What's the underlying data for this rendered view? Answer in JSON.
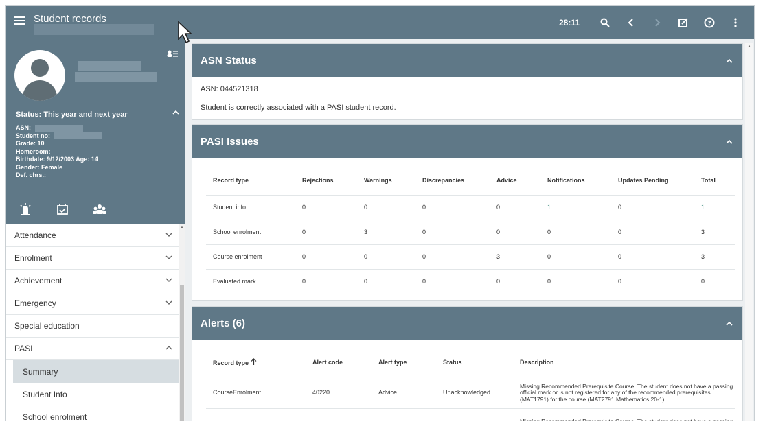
{
  "topbar": {
    "title": "Student records",
    "timer": "28:11"
  },
  "sidebar": {
    "status": "Status: This year and next year",
    "details": {
      "asn_label": "ASN:",
      "student_no_label": "Student no:",
      "grade": "Grade:  10",
      "homeroom": "Homeroom:",
      "birthdate": "Birthdate:  9/12/2003    Age:  14",
      "gender": "Gender:  Female",
      "def_chrs": "Def. chrs.:"
    },
    "nav": [
      {
        "label": "Attendance"
      },
      {
        "label": "Enrolment"
      },
      {
        "label": "Achievement"
      },
      {
        "label": "Emergency"
      },
      {
        "label": "Special education"
      },
      {
        "label": "PASI"
      }
    ],
    "sub_nav": [
      {
        "label": "Summary"
      },
      {
        "label": "Student Info"
      },
      {
        "label": "School enrolment"
      }
    ]
  },
  "asn_status": {
    "title": "ASN Status",
    "asn_line": "ASN: 044521318",
    "message": "Student is correctly associated with a PASI student record."
  },
  "pasi_issues": {
    "title": "PASI Issues",
    "columns": [
      "Record type",
      "Rejections",
      "Warnings",
      "Discrepancies",
      "Advice",
      "Notifications",
      "Updates Pending",
      "Total"
    ],
    "rows": [
      [
        "Student info",
        "0",
        "0",
        "0",
        "0",
        "1",
        "0",
        "1"
      ],
      [
        "School enrolment",
        "0",
        "3",
        "0",
        "0",
        "0",
        "0",
        "3"
      ],
      [
        "Course enrolment",
        "0",
        "0",
        "0",
        "3",
        "0",
        "0",
        "3"
      ],
      [
        "Evaluated mark",
        "0",
        "0",
        "0",
        "0",
        "0",
        "0",
        "0"
      ]
    ]
  },
  "alerts": {
    "title": "Alerts (6)",
    "columns": [
      "Record type",
      "Alert code",
      "Alert type",
      "Status",
      "Description"
    ],
    "rows": [
      [
        "CourseEnrolment",
        "40220",
        "Advice",
        "Unacknowledged",
        "Missing Recommended Prerequisite Course. The student does not have a passing official mark or is not registered for any of the recommended prerequisites (MAT1791) for the course (MAT2791 Mathematics 20-1)."
      ],
      [
        "",
        "",
        "",
        "",
        "Missing Recommended Prerequisite Course. The student does not have a passing official mark or is not registered for any of the"
      ]
    ]
  },
  "colors": {
    "header": "#5f7887",
    "link": "#3a8a7c"
  }
}
